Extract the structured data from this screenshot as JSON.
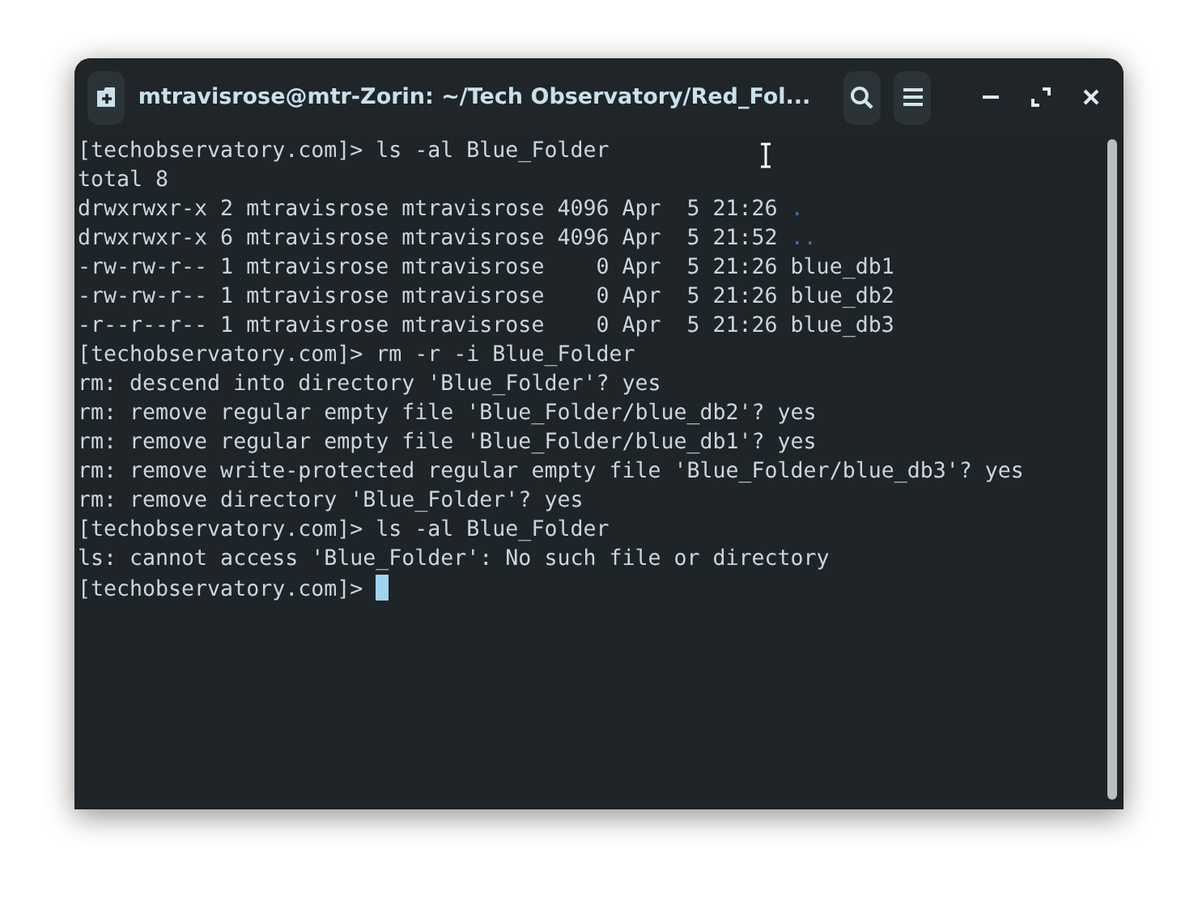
{
  "window": {
    "title": "mtravisrose@mtr-Zorin: ~/Tech Observatory/Red_Fol..."
  },
  "terminal": {
    "lines": [
      {
        "segments": [
          {
            "kind": "plain",
            "text": "[techobservatory.com]> ls -al Blue_Folder"
          }
        ]
      },
      {
        "segments": [
          {
            "kind": "plain",
            "text": "total 8"
          }
        ]
      },
      {
        "segments": [
          {
            "kind": "plain",
            "text": "drwxrwxr-x 2 mtravisrose mtravisrose 4096 Apr  5 21:26 "
          },
          {
            "kind": "directory",
            "text": "."
          }
        ]
      },
      {
        "segments": [
          {
            "kind": "plain",
            "text": "drwxrwxr-x 6 mtravisrose mtravisrose 4096 Apr  5 21:52 "
          },
          {
            "kind": "directory",
            "text": ".."
          }
        ]
      },
      {
        "segments": [
          {
            "kind": "plain",
            "text": "-rw-rw-r-- 1 mtravisrose mtravisrose    0 Apr  5 21:26 blue_db1"
          }
        ]
      },
      {
        "segments": [
          {
            "kind": "plain",
            "text": "-rw-rw-r-- 1 mtravisrose mtravisrose    0 Apr  5 21:26 blue_db2"
          }
        ]
      },
      {
        "segments": [
          {
            "kind": "plain",
            "text": "-r--r--r-- 1 mtravisrose mtravisrose    0 Apr  5 21:26 blue_db3"
          }
        ]
      },
      {
        "segments": [
          {
            "kind": "plain",
            "text": "[techobservatory.com]> rm -r -i Blue_Folder"
          }
        ]
      },
      {
        "segments": [
          {
            "kind": "plain",
            "text": "rm: descend into directory 'Blue_Folder'? yes"
          }
        ]
      },
      {
        "segments": [
          {
            "kind": "plain",
            "text": "rm: remove regular empty file 'Blue_Folder/blue_db2'? yes"
          }
        ]
      },
      {
        "segments": [
          {
            "kind": "plain",
            "text": "rm: remove regular empty file 'Blue_Folder/blue_db1'? yes"
          }
        ]
      },
      {
        "segments": [
          {
            "kind": "plain",
            "text": "rm: remove write-protected regular empty file 'Blue_Folder/blue_db3'? yes"
          }
        ]
      },
      {
        "segments": [
          {
            "kind": "plain",
            "text": "rm: remove directory 'Blue_Folder'? yes"
          }
        ]
      },
      {
        "segments": [
          {
            "kind": "plain",
            "text": "[techobservatory.com]> ls -al Blue_Folder"
          }
        ]
      },
      {
        "segments": [
          {
            "kind": "plain",
            "text": "ls: cannot access 'Blue_Folder': No such file or directory"
          }
        ]
      },
      {
        "segments": [
          {
            "kind": "plain",
            "text": "[techobservatory.com]> "
          }
        ]
      }
    ]
  }
}
